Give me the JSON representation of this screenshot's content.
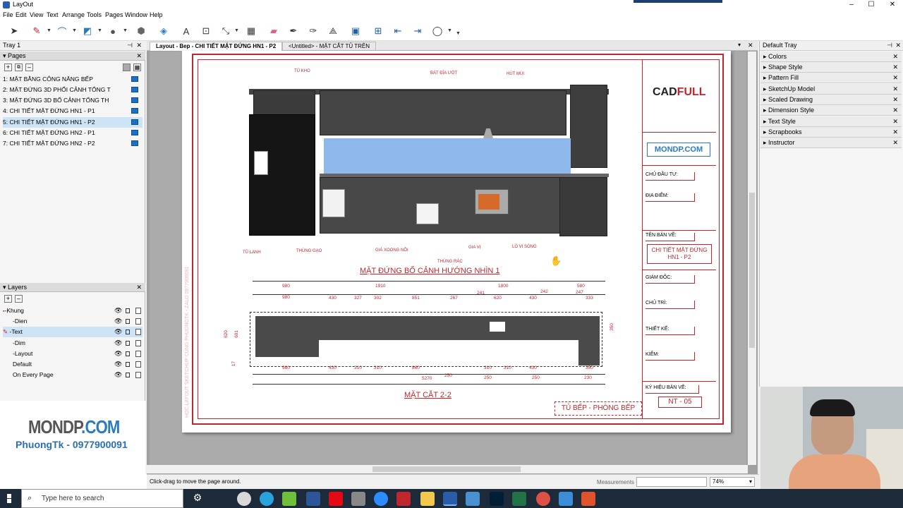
{
  "window": {
    "title": "LayOut"
  },
  "menu": [
    "File",
    "Edit",
    "View",
    "Text",
    "Arrange",
    "Tools",
    "Pages",
    "Window",
    "Help"
  ],
  "tray1": {
    "title": "Tray 1"
  },
  "pages_panel": {
    "title": "Pages",
    "items": [
      {
        "num": "1:",
        "label": "MẶT BẰNG CÔNG NĂNG BẾP"
      },
      {
        "num": "2:",
        "label": "MẶT ĐỨNG 3D PHỐI CẢNH TỔNG T"
      },
      {
        "num": "3:",
        "label": "MẶT ĐỨNG 3D BỐ CẢNH TỔNG TH"
      },
      {
        "num": "4:",
        "label": "CHI TIẾT MẶT ĐỨNG HN1 - P1"
      },
      {
        "num": "5:",
        "label": "CHI TIẾT MẶT ĐỨNG HN1 - P2"
      },
      {
        "num": "6:",
        "label": "CHI TIẾT MẶT ĐỨNG HN2 - P1"
      },
      {
        "num": "7:",
        "label": "CHI TIẾT MẶT ĐỨNG HN2 - P2"
      }
    ]
  },
  "layers_panel": {
    "title": "Layers",
    "items": [
      "-Khung",
      "-Dien",
      "-Text",
      "-Dim",
      "-Layout",
      "Default",
      "On Every Page"
    ]
  },
  "brand": {
    "site": "MONDP",
    "tld": ".COM",
    "contact": "PhuongTk - 0977900091"
  },
  "doc_tabs": [
    "Layout - Bep - CHI TIẾT MẶT ĐỨNG HN1 - P2",
    "<Untitled> - MẶT CẮT TỦ TRÊN"
  ],
  "drawing": {
    "labels_top": [
      "TỦ KHO",
      "BÁT ĐĨA ƯỚT",
      "HÚT MÙI"
    ],
    "labels_bottom": [
      "TỦ LẠNH",
      "THÙNG GẠO",
      "GIÁ XOONG NỒI",
      "THÙNG RÁC",
      "GIA VỊ",
      "LÒ VI SÓNG"
    ],
    "title1": "MẶT ĐỨNG BỐ CẢNH HƯỚNG NHÌN 1",
    "title2": "MẶT CẮT 2-2",
    "dims_top1": [
      "980",
      "1910",
      "1800",
      "580"
    ],
    "dims_top2": [
      "980",
      "430",
      "327",
      "302",
      "851",
      "267",
      "241",
      "620",
      "430",
      "242",
      "247",
      "333"
    ],
    "dims_bottom1": [
      "980",
      "430",
      "310",
      "310",
      "860",
      "310",
      "310",
      "430",
      "350"
    ],
    "dims_bottom2": [
      "5270",
      "250",
      "250",
      "250",
      "230"
    ],
    "dims_side": [
      "620",
      "601",
      "17",
      "350"
    ],
    "footer": "TỦ BẾP - PHÒNG BẾP",
    "vertical_text": "HỌC LAYOUT SKETCHUP CÙNG PHUONGTK - ZALO 0977900091"
  },
  "titleblock": {
    "logo1": "CAD",
    "logo2": "FULL",
    "site": "MONDP.COM",
    "fields": [
      "CHỦ ĐẦU TƯ:",
      "ĐỊA ĐIỂM:",
      "TÊN BẢN VẼ:",
      "GIÁM ĐỐC:",
      "CHỦ TRÌ:",
      "THIẾT KẾ:",
      "KIỂM:",
      "KÝ HIỆU BẢN VẼ:"
    ],
    "drawing_name": "CHI TIẾT MẶT ĐỨNG HN1 - P2",
    "code": "NT - 05"
  },
  "default_tray": {
    "title": "Default Tray",
    "items": [
      "Colors",
      "Shape Style",
      "Pattern Fill",
      "SketchUp Model",
      "Scaled Drawing",
      "Dimension Style",
      "Text Style",
      "Scrapbooks",
      "Instructor"
    ]
  },
  "status": {
    "hint": "Click-drag to move the page around.",
    "measurements_label": "Measurements",
    "zoom": "74%"
  },
  "taskbar": {
    "search_placeholder": "Type here to search"
  }
}
